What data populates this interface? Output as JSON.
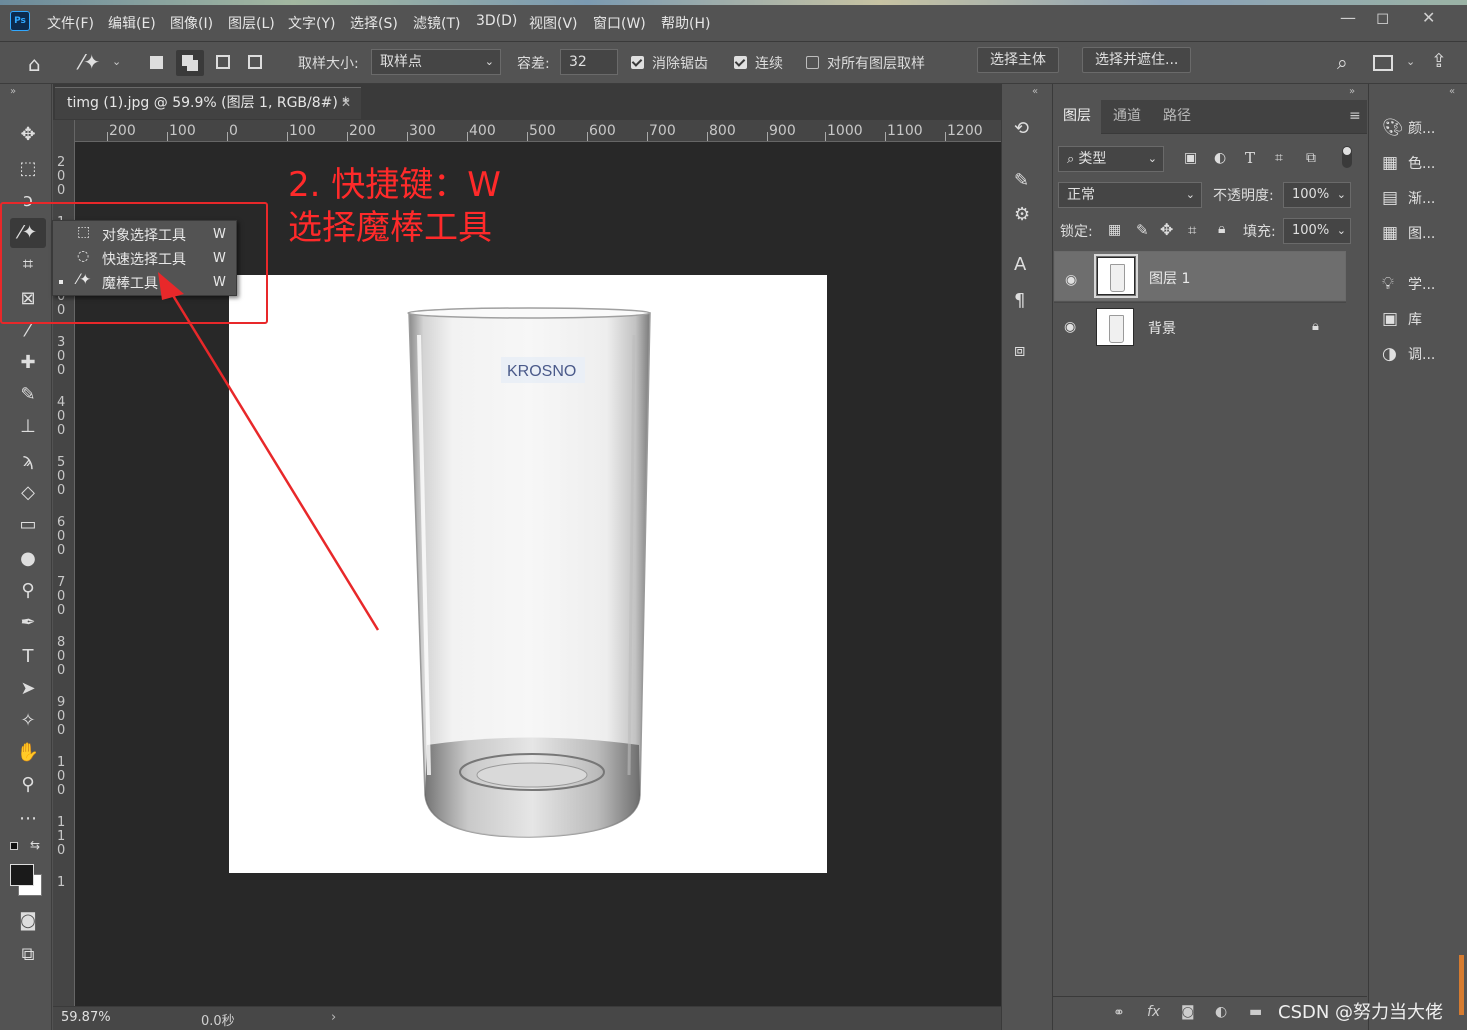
{
  "app": {
    "logo": "Ps"
  },
  "menu": [
    "文件(F)",
    "编辑(E)",
    "图像(I)",
    "图层(L)",
    "文字(Y)",
    "选择(S)",
    "滤镜(T)",
    "3D(D)",
    "视图(V)",
    "窗口(W)",
    "帮助(H)"
  ],
  "window_controls": {
    "minimize": "—",
    "restore": "◻",
    "close": "✕"
  },
  "options": {
    "sample_size_label": "取样大小:",
    "sample_size_value": "取样点",
    "tolerance_label": "容差:",
    "tolerance_value": "32",
    "anti_alias": "消除锯齿",
    "contiguous": "连续",
    "sample_all_layers": "对所有图层取样",
    "select_subject": "选择主体",
    "select_and_mask": "选择并遮住..."
  },
  "document": {
    "tab_title": "timg (1).jpg @ 59.9% (图层 1, RGB/8#) *",
    "zoom": "59.87%",
    "timer": "0.0秒",
    "ruler_h": [
      "200",
      "100",
      "0",
      "100",
      "200",
      "300",
      "400",
      "500",
      "600",
      "700",
      "800",
      "900",
      "1000",
      "1100",
      "1200"
    ],
    "ruler_v": [
      "2\n0\n0",
      "1\n0\n0",
      "2\n0\n0",
      "3\n0\n0",
      "4\n0\n0",
      "5\n0\n0",
      "6\n0\n0",
      "7\n0\n0",
      "8\n0\n0",
      "9\n0\n0",
      "1\n0\n0",
      "1\n1\n0",
      "1"
    ]
  },
  "flyout": [
    {
      "label": "对象选择工具",
      "key": "W"
    },
    {
      "label": "快速选择工具",
      "key": "W"
    },
    {
      "label": "魔棒工具",
      "key": "W"
    }
  ],
  "annotation": {
    "line1": "2. 快捷键：W",
    "line2": "选择魔棒工具",
    "color": "#ff2a2a"
  },
  "image_brand": "KROSNO",
  "layers_panel": {
    "tabs": [
      "图层",
      "通道",
      "路径"
    ],
    "filter": "类型",
    "blend_mode": "正常",
    "opacity_label": "不透明度:",
    "opacity_value": "100%",
    "lock_label": "锁定:",
    "fill_label": "填充:",
    "fill_value": "100%",
    "layers": [
      {
        "name": "图层 1",
        "selected": true
      },
      {
        "name": "背景",
        "locked": true
      }
    ]
  },
  "right_panels": [
    "颜...",
    "色...",
    "渐...",
    "图...",
    "学...",
    "库",
    "调..."
  ],
  "watermark": "CSDN @努力当大佬"
}
